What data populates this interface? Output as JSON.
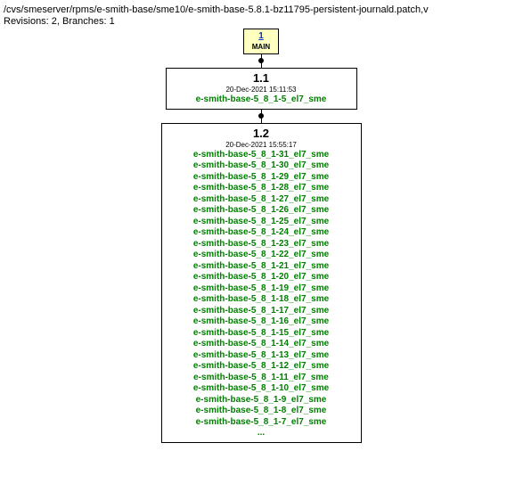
{
  "header": {
    "path": "/cvs/smeserver/rpms/e-smith-base/sme10/e-smith-base-5.8.1-bz11795-persistent-journald.patch,v",
    "meta": "Revisions: 2, Branches: 1"
  },
  "main": {
    "num": "1",
    "label": "MAIN"
  },
  "rev11": {
    "rev": "1.1",
    "date": "20-Dec-2021 15:11:53",
    "tags": [
      "e-smith-base-5_8_1-5_el7_sme"
    ]
  },
  "rev12": {
    "rev": "1.2",
    "date": "20-Dec-2021 15:55:17",
    "tags": [
      "e-smith-base-5_8_1-31_el7_sme",
      "e-smith-base-5_8_1-30_el7_sme",
      "e-smith-base-5_8_1-29_el7_sme",
      "e-smith-base-5_8_1-28_el7_sme",
      "e-smith-base-5_8_1-27_el7_sme",
      "e-smith-base-5_8_1-26_el7_sme",
      "e-smith-base-5_8_1-25_el7_sme",
      "e-smith-base-5_8_1-24_el7_sme",
      "e-smith-base-5_8_1-23_el7_sme",
      "e-smith-base-5_8_1-22_el7_sme",
      "e-smith-base-5_8_1-21_el7_sme",
      "e-smith-base-5_8_1-20_el7_sme",
      "e-smith-base-5_8_1-19_el7_sme",
      "e-smith-base-5_8_1-18_el7_sme",
      "e-smith-base-5_8_1-17_el7_sme",
      "e-smith-base-5_8_1-16_el7_sme",
      "e-smith-base-5_8_1-15_el7_sme",
      "e-smith-base-5_8_1-14_el7_sme",
      "e-smith-base-5_8_1-13_el7_sme",
      "e-smith-base-5_8_1-12_el7_sme",
      "e-smith-base-5_8_1-11_el7_sme",
      "e-smith-base-5_8_1-10_el7_sme",
      "e-smith-base-5_8_1-9_el7_sme",
      "e-smith-base-5_8_1-8_el7_sme",
      "e-smith-base-5_8_1-7_el7_sme"
    ],
    "ellipsis": "..."
  }
}
